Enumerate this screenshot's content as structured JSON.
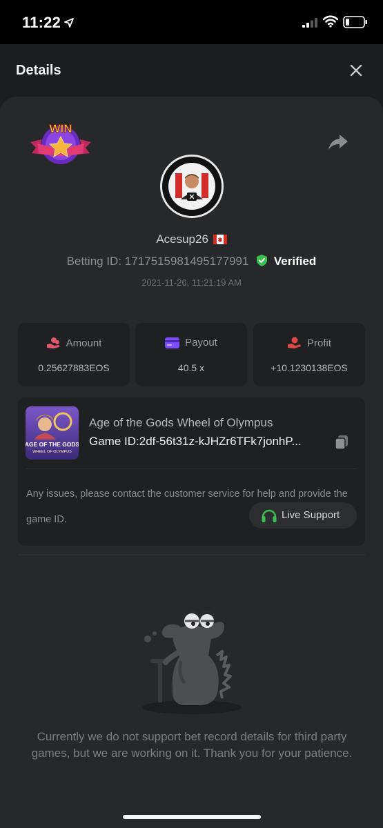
{
  "status_bar": {
    "time": "11:22"
  },
  "header": {
    "title": "Details"
  },
  "badge": {
    "text": "WIN"
  },
  "player": {
    "username": "Acesup26",
    "betting_id_label": "Betting ID:",
    "betting_id": "1717515981495177991",
    "verified_label": "Verified",
    "timestamp": "2021-11-26, 11:21:19 AM"
  },
  "stats": [
    {
      "label": "Amount",
      "value": "0.25627883EOS",
      "icon": "coins-hand-icon"
    },
    {
      "label": "Payout",
      "value": "40.5 x",
      "icon": "card-icon"
    },
    {
      "label": "Profit",
      "value": "+10.1230138EOS",
      "icon": "person-hand-icon"
    }
  ],
  "game": {
    "name": "Age of the Gods Wheel of Olympus",
    "id_label": "Game ID:",
    "id_value": "2df-56t31z-kJHZr6TFk7jonhP...",
    "thumb_title": "AGE OF THE GODS",
    "thumb_subtitle": "WHEEL OF OLYMPUS",
    "notice": "Any issues, please contact the customer service for help and provide the game ID.",
    "support_label": "Live Support"
  },
  "empty_message": "Currently we do not support bet record details for third party games, but we are working on it. Thank you for your patience.",
  "colors": {
    "background": "#1c1d1f",
    "sheet": "#272829",
    "card": "#1f2021",
    "verified_green": "#3bbf4f",
    "amount_pink": "#e0566f",
    "payout_purple": "#7c4dff",
    "profit_red": "#e04848"
  }
}
